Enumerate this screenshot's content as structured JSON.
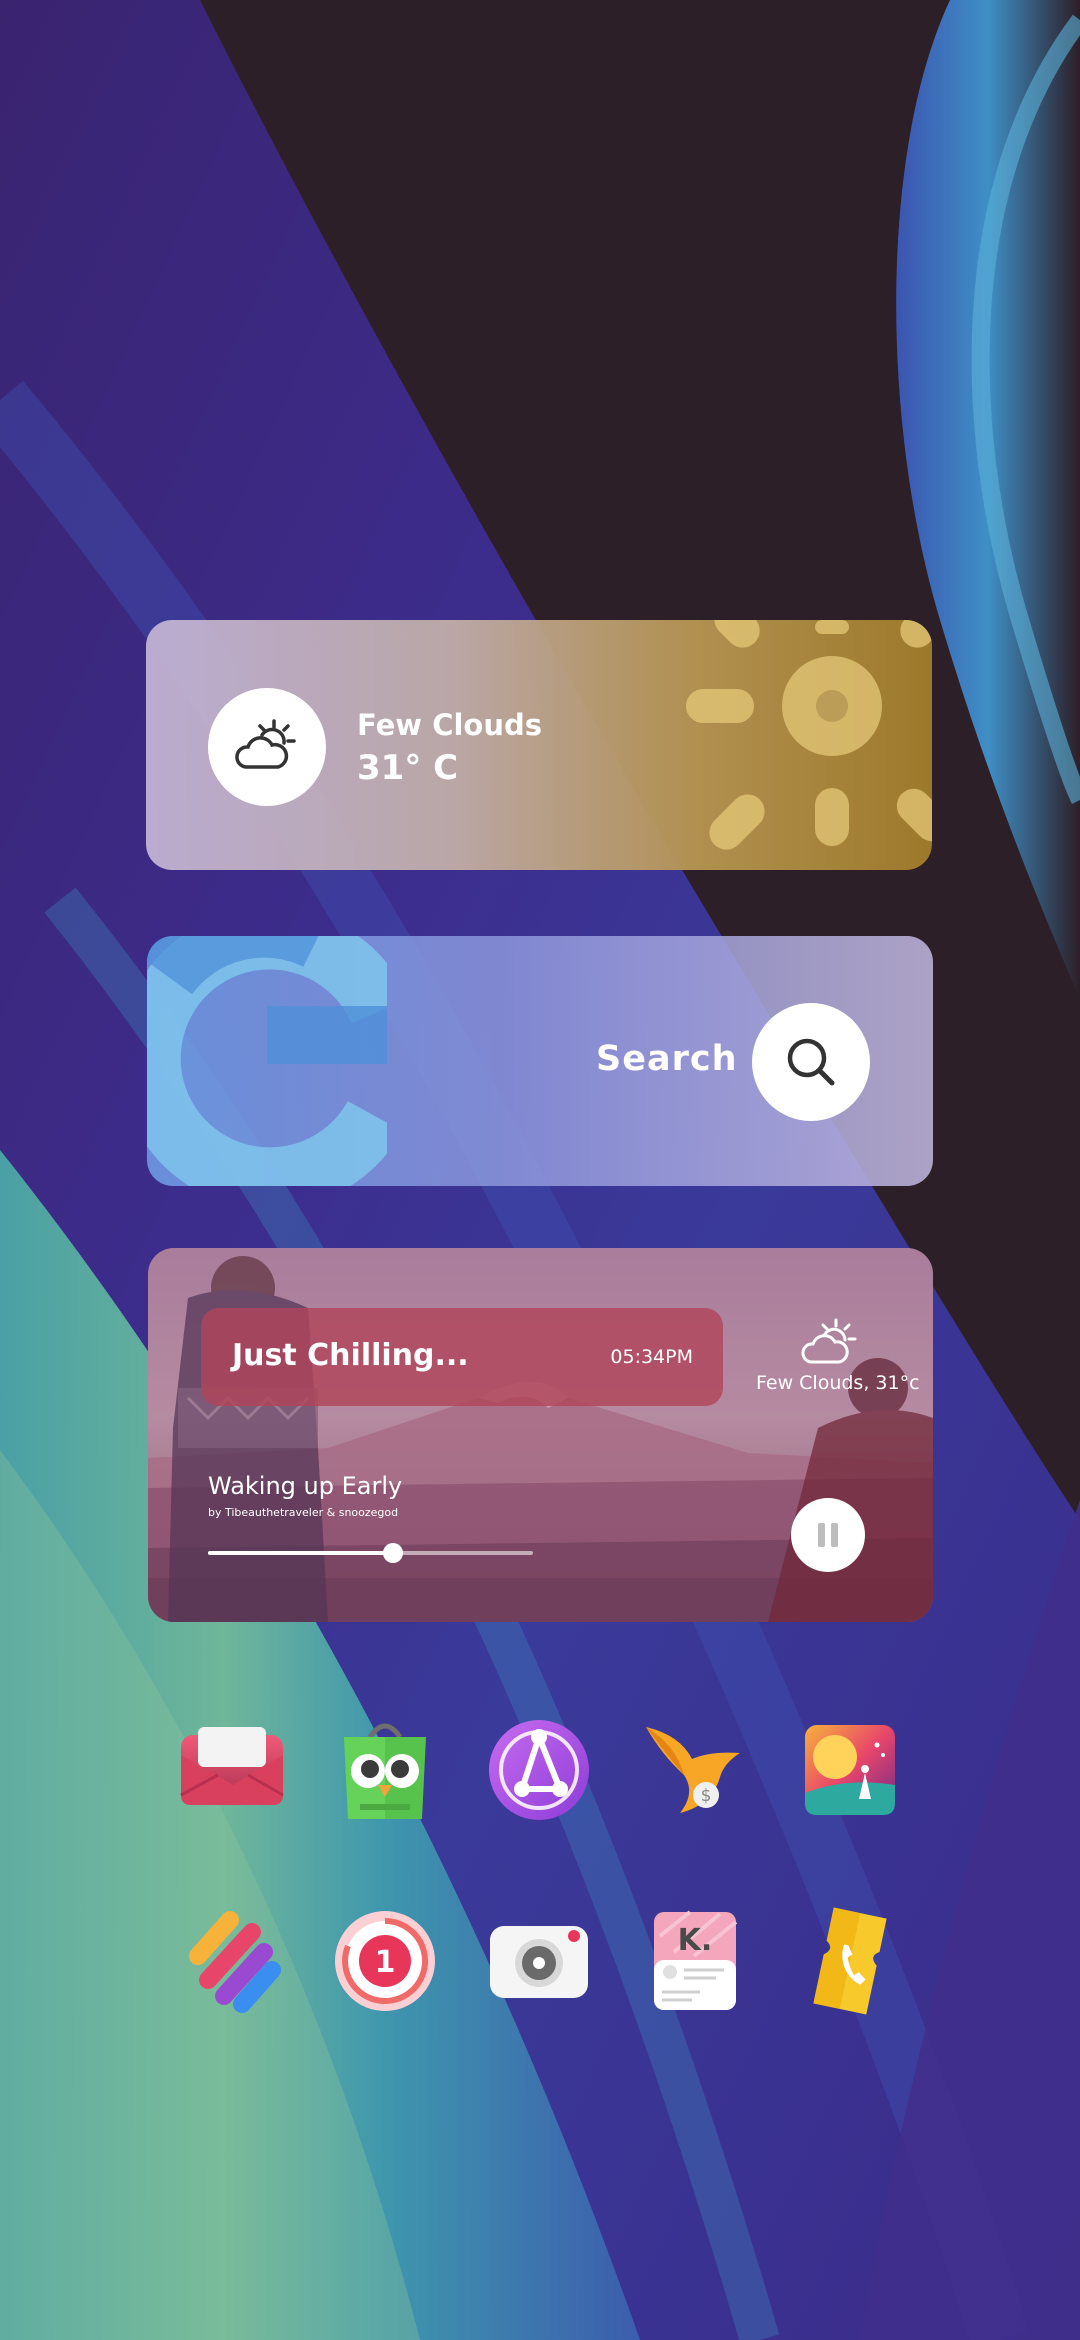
{
  "weather_widget": {
    "condition": "Few Clouds",
    "temperature": "31° C",
    "icon": "partly-cloudy-icon",
    "colors": {
      "gold": "#a07c2a",
      "lavender": "#c4b5d6"
    }
  },
  "search_widget": {
    "label": "Search",
    "logo": "google-g-logo",
    "icon": "search-icon"
  },
  "music_widget": {
    "banner_title": "Just Chilling...",
    "time": "05:34PM",
    "weather": "Few Clouds, 31°c",
    "song_title": "Waking up Early",
    "artist": "by Tibeauthetraveler & snoozegod",
    "progress": 0.57,
    "state": "playing",
    "control_icon": "pause-icon"
  },
  "dock": {
    "row1": [
      {
        "icon": "mail-envelope-icon"
      },
      {
        "icon": "owl-shopping-bag-icon"
      },
      {
        "icon": "network-nodes-icon"
      },
      {
        "icon": "bird-money-icon"
      },
      {
        "icon": "sunset-art-icon"
      }
    ],
    "row2": [
      {
        "icon": "stripes-app-icon"
      },
      {
        "icon": "number-one-badge-icon"
      },
      {
        "icon": "camera-icon"
      },
      {
        "icon": "receipt-k-icon"
      },
      {
        "icon": "ticket-phone-icon"
      }
    ]
  }
}
